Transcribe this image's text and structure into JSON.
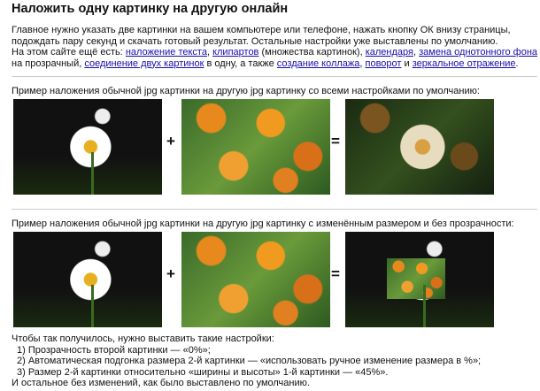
{
  "title": "Наложить одну картинку на другую онлайн",
  "intro": {
    "line1": "Главное нужно указать две картинки на вашем компьютере или телефоне, нажать кнопку ОК внизу страницы, подождать пару секунд и скачать готовый результат. Остальные настройки уже выставлены по умолчанию.",
    "also_prefix": "На этом сайте ещё есть: ",
    "links": [
      "наложение текста",
      "клипартов",
      "календаря",
      "замена однотонного фона",
      "соединение двух картинок",
      "создание коллажа",
      "поворот",
      "зеркальное отражение"
    ],
    "t1": ", ",
    "t2": " (множества картинок), ",
    "t3": ", ",
    "t4": " на прозрачный, ",
    "t5": " в одну, а также ",
    "t6": ", ",
    "t7": " и ",
    "t8": "."
  },
  "example1": {
    "caption": "Пример наложения обычной jpg картинки на другую jpg картинку со всеми настройками по умолчанию:",
    "plus": "+",
    "equals": "="
  },
  "example2": {
    "caption": "Пример наложения обычной jpg картинки на другую jpg картинку с изменённым размером и без прозрачности:",
    "plus": "+",
    "equals": "="
  },
  "settings": {
    "heading": "Чтобы так получилось, нужно выставить такие настройки:",
    "items": [
      "1) Прозрачность второй картинки — «0%»;",
      "2) Автоматическая подгонка размера 2-й картинки — «использовать ручное изменение размера в %»;",
      "3) Размер 2-й картинки относительно «ширины и высоты» 1-й картинки — «45%»."
    ],
    "footer": "И остальное без изменений, как было выставлено по умолчанию."
  }
}
